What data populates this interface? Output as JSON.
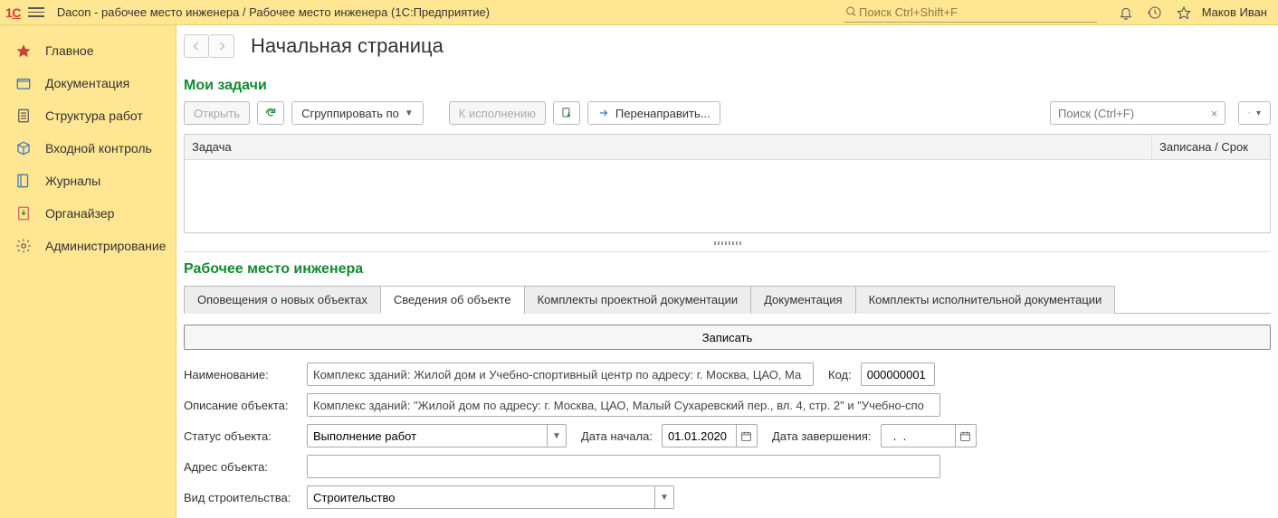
{
  "titlebar": {
    "app_title": "Dacon - рабочее место инженера / Рабочее место инженера  (1С:Предприятие)",
    "search_placeholder": "Поиск Ctrl+Shift+F",
    "user": "Маков Иван"
  },
  "sidebar": {
    "items": [
      {
        "label": "Главное"
      },
      {
        "label": "Документация"
      },
      {
        "label": "Структура работ"
      },
      {
        "label": "Входной контроль"
      },
      {
        "label": "Журналы"
      },
      {
        "label": "Органайзер"
      },
      {
        "label": "Администрирование"
      }
    ]
  },
  "page": {
    "title": "Начальная страница"
  },
  "tasks": {
    "section_title": "Мои задачи",
    "open_btn": "Открыть",
    "group_btn": "Сгруппировать по",
    "due_btn": "К исполнению",
    "forward_btn": "Перенаправить...",
    "search_placeholder": "Поиск (Ctrl+F)",
    "col_task": "Задача",
    "col_date": "Записана / Срок"
  },
  "workplace": {
    "section_title": "Рабочее место инженера",
    "tabs": [
      "Оповещения о новых объектах",
      "Сведения об объекте",
      "Комплекты проектной документации",
      "Документация",
      "Комплекты исполнительной документации"
    ],
    "active_tab_index": 1,
    "save_btn": "Записать",
    "fields": {
      "name_label": "Наименование:",
      "name_value": "Комплекс зданий: Жилой дом и Учебно-спортивный центр по адресу: г. Москва, ЦАО, Ма",
      "code_label": "Код:",
      "code_value": "000000001",
      "desc_label": "Описание объекта:",
      "desc_value": "Комплекс зданий: \"Жилой дом по адресу: г. Москва, ЦАО, Малый Сухаревский пер., вл. 4, стр. 2\" и \"Учебно-спо",
      "status_label": "Статус объекта:",
      "status_value": "Выполнение работ",
      "date_start_label": "Дата начала:",
      "date_start_value": "01.01.2020",
      "date_end_label": "Дата завершения:",
      "date_end_value": "  .  .",
      "address_label": "Адрес объекта:",
      "address_value": "",
      "build_type_label": "Вид строительства:",
      "build_type_value": "Строительство"
    }
  }
}
